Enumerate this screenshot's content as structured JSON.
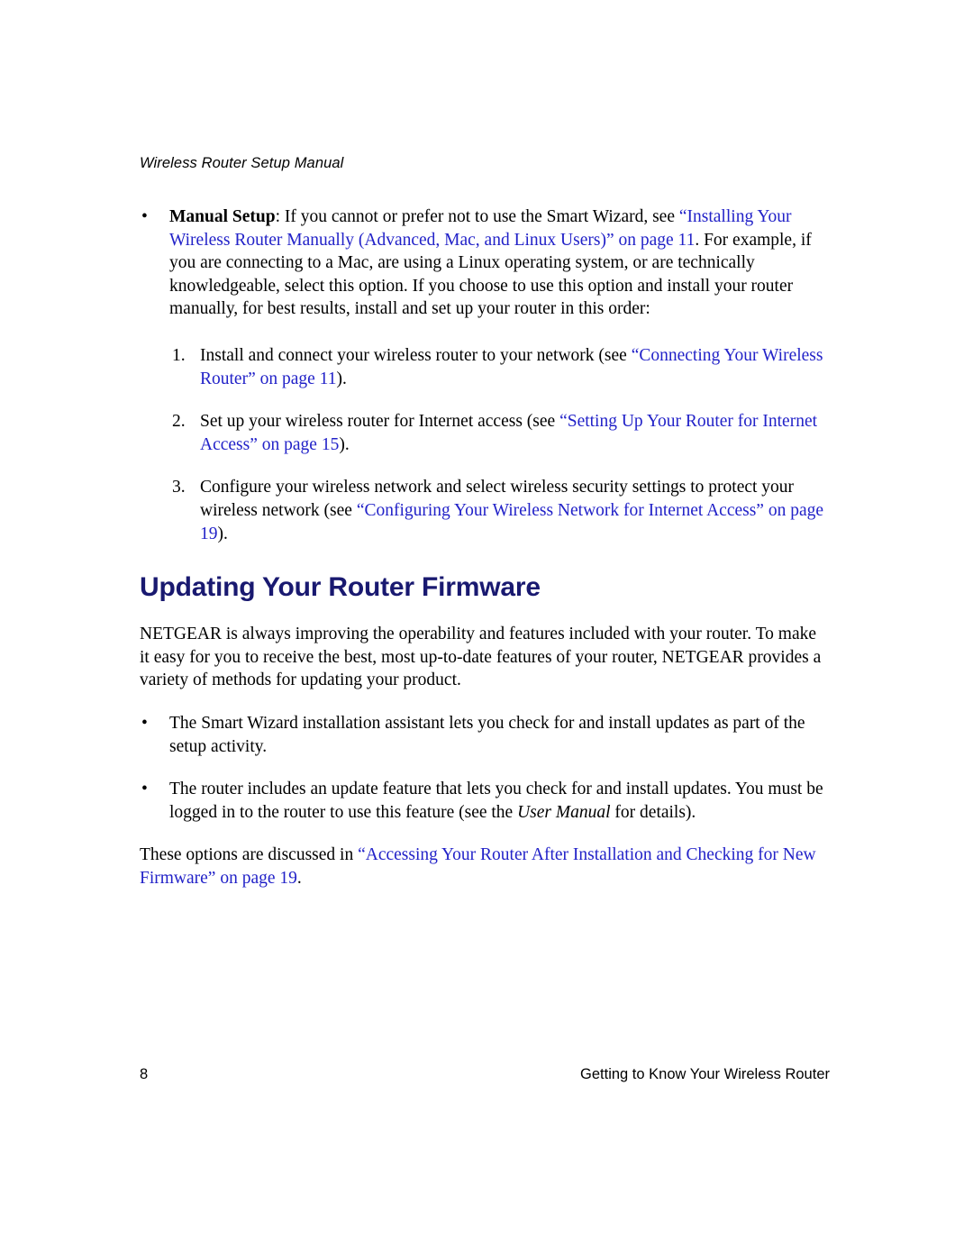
{
  "header": {
    "running_title": "Wireless Router Setup Manual"
  },
  "colors": {
    "link_blue": "#2222c8",
    "heading_navy": "#191970",
    "body_black": "#000000",
    "page_background": "#ffffff"
  },
  "content": {
    "manual_setup_bullet": {
      "marker": "•",
      "lead_label": "Manual Setup",
      "text_before_link": ": If you cannot or prefer not to use the Smart Wizard, see ",
      "link_text": "“Installing Your Wireless Router Manually (Advanced, Mac, and Linux Users)” on page 11",
      "text_after_link": ". For example, if you are connecting to a Mac, are using a Linux operating system, or are technically knowledgeable, select this option. If you choose to use this option and install your router manually, for best results, install and set up your router in this order:"
    },
    "numbered_steps": [
      {
        "marker": "1.",
        "text_before_link": "Install and connect your wireless router to your network (see ",
        "link_text": "“Connecting Your Wireless Router” on page 11",
        "text_after_link": ")."
      },
      {
        "marker": "2.",
        "text_before_link": "Set up your wireless router for Internet access (see ",
        "link_text": "“Setting Up Your Router for Internet Access” on page 15",
        "text_after_link": ")."
      },
      {
        "marker": "3.",
        "text_before_link": "Configure your wireless network and select wireless security settings to protect your wireless network (see ",
        "link_text": "“Configuring Your Wireless Network for Internet Access” on page 19",
        "text_after_link": ")."
      }
    ],
    "section_heading": "Updating Your Router Firmware",
    "intro_paragraph": "NETGEAR is always improving the operability and features included with your router. To make it easy for you to receive the best, most up-to-date features of your router, NETGEAR provides a variety of methods for updating your product.",
    "method_bullets": [
      {
        "marker": "•",
        "text": "The Smart Wizard installation assistant lets you check for and install updates as part of the setup activity."
      },
      {
        "marker": "•",
        "text_before_italic": "The router includes an update feature that lets you check for and install updates. You must be logged in to the router to use this feature (see the ",
        "italic_text": "User Manual",
        "text_after_italic": " for details)."
      }
    ],
    "closing_paragraph": {
      "text_before_link": "These options are discussed in ",
      "link_text": "“Accessing Your Router After Installation and Checking for New Firmware” on page 19",
      "text_after_link": "."
    }
  },
  "footer": {
    "page_number": "8",
    "chapter_title": "Getting to Know Your Wireless Router"
  }
}
